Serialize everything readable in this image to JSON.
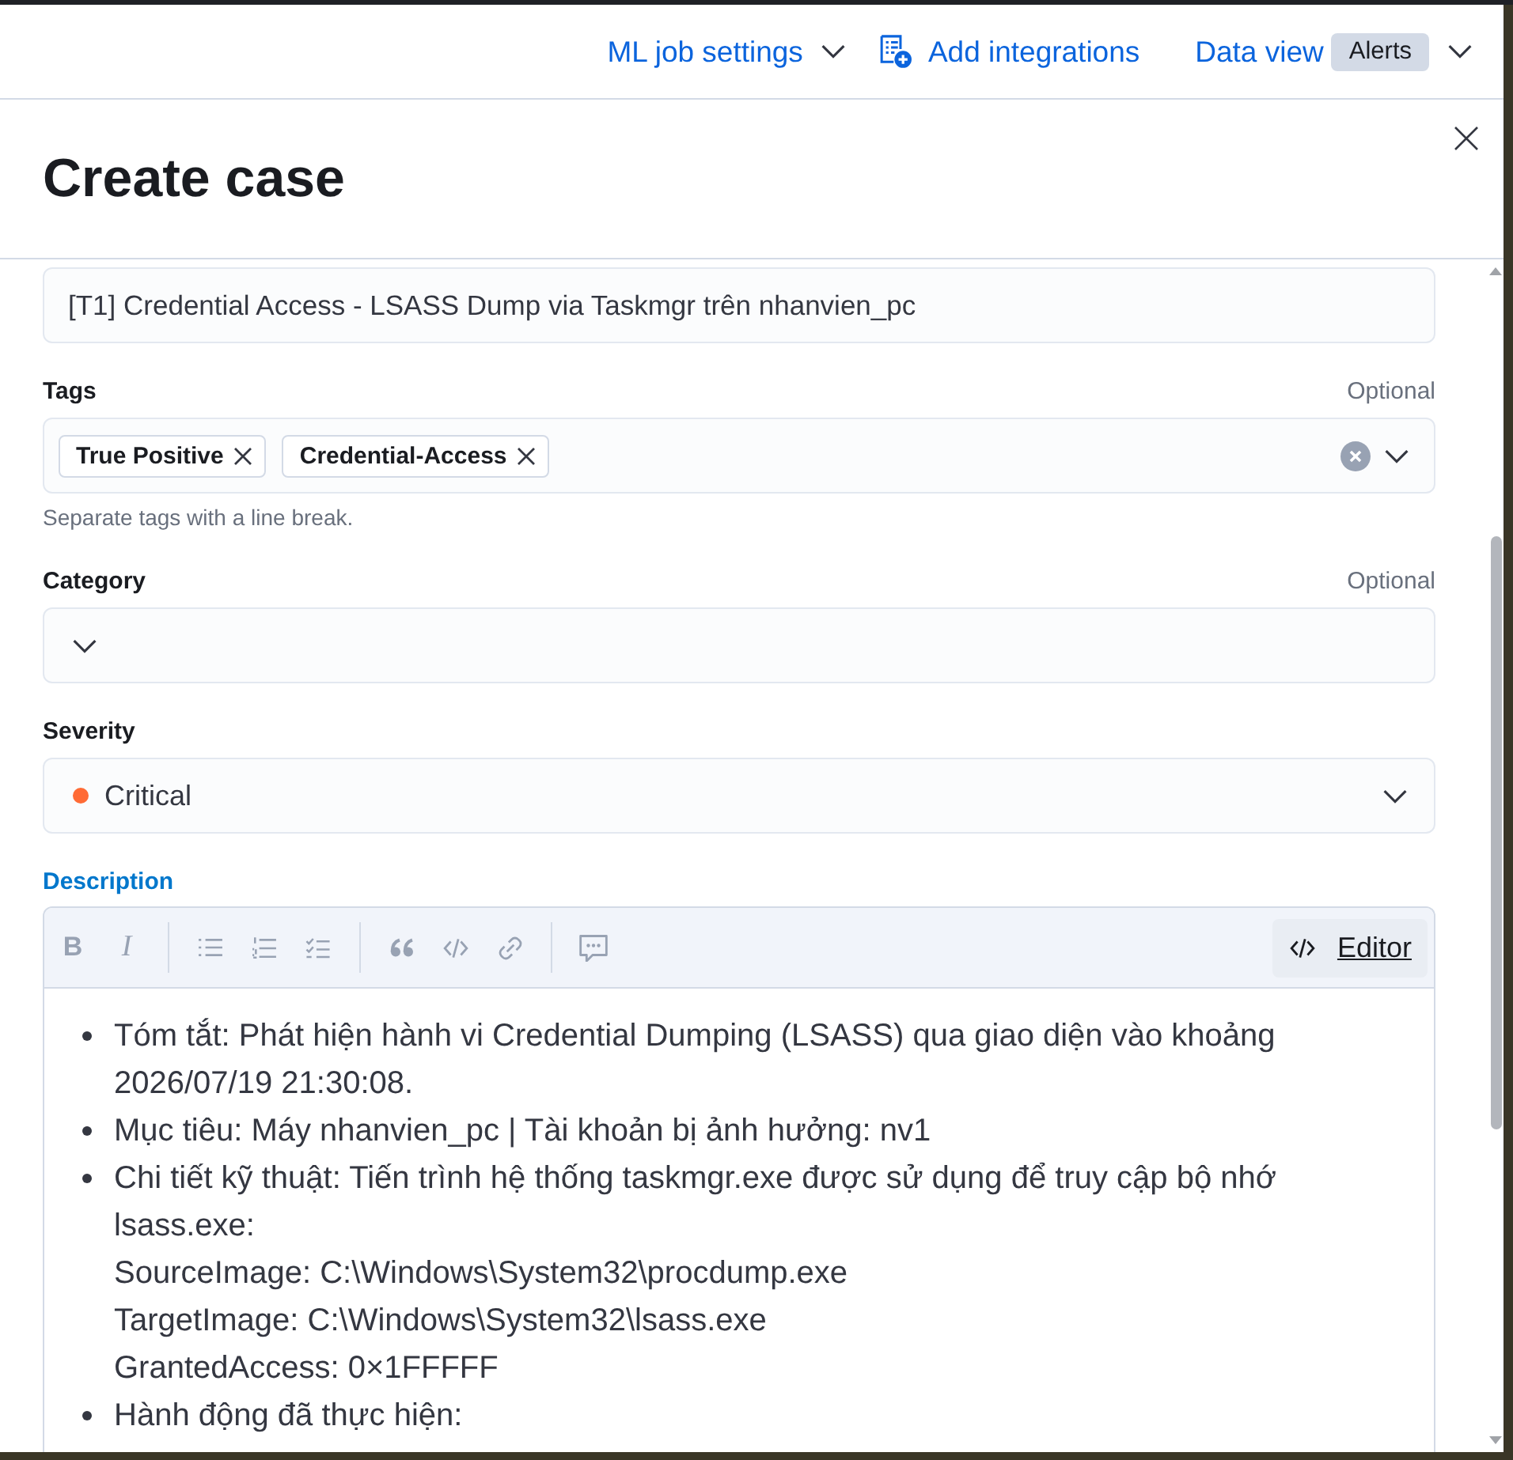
{
  "top_bar": {
    "items": [
      {
        "kind": "menu",
        "label": "ML job settings"
      },
      {
        "kind": "add",
        "label": "Add integrations"
      },
      {
        "kind": "data_view",
        "label": "Data view",
        "badge": "Alerts"
      }
    ]
  },
  "flyout": {
    "title": "Create case"
  },
  "form": {
    "title_field": {
      "value": "[T1] Credential Access - LSASS Dump via Taskmgr trên nhanvien_pc"
    },
    "fields": [
      {
        "kind": "tags",
        "label": "Tags",
        "optional": "Optional",
        "chips": [
          "True Positive",
          "Credential-Access"
        ],
        "help": "Separate tags with a line break."
      },
      {
        "kind": "select",
        "label": "Category",
        "optional": "Optional"
      },
      {
        "kind": "severity",
        "label": "Severity",
        "value": "Critical",
        "color": "#ff6b35"
      },
      {
        "kind": "markdown",
        "label": "Description",
        "focused": true,
        "toolbar": [
          [
            {
              "kind": "bold",
              "label": "B"
            },
            {
              "kind": "italic",
              "label": "I"
            }
          ],
          [
            {
              "kind": "bullet_list"
            },
            {
              "kind": "numbered_list"
            },
            {
              "kind": "task_list"
            }
          ],
          [
            {
              "kind": "quote"
            },
            {
              "kind": "code"
            },
            {
              "kind": "link"
            }
          ],
          [
            {
              "kind": "comment"
            }
          ]
        ],
        "mode_button": "Editor",
        "bullets": [
          "Tóm tắt: Phát hiện hành vi Credential Dumping (LSASS) qua giao diện vào khoảng 2026/07/19 21:30:08.",
          "Mục tiêu: Máy nhanvien_pc | Tài khoản bị ảnh hưởng: nv1",
          "Chi tiết kỹ thuật: Tiến trình hệ thống taskmgr.exe được sử dụng để truy cập bộ nhớ lsass.exe:\nSourceImage: C:\\Windows\\System32\\procdump.exe\nTargetImage: C:\\Windows\\System32\\lsass.exe\nGrantedAccess: 0×1FFFFF",
          "Hành động đã thực hiện:"
        ]
      }
    ]
  }
}
